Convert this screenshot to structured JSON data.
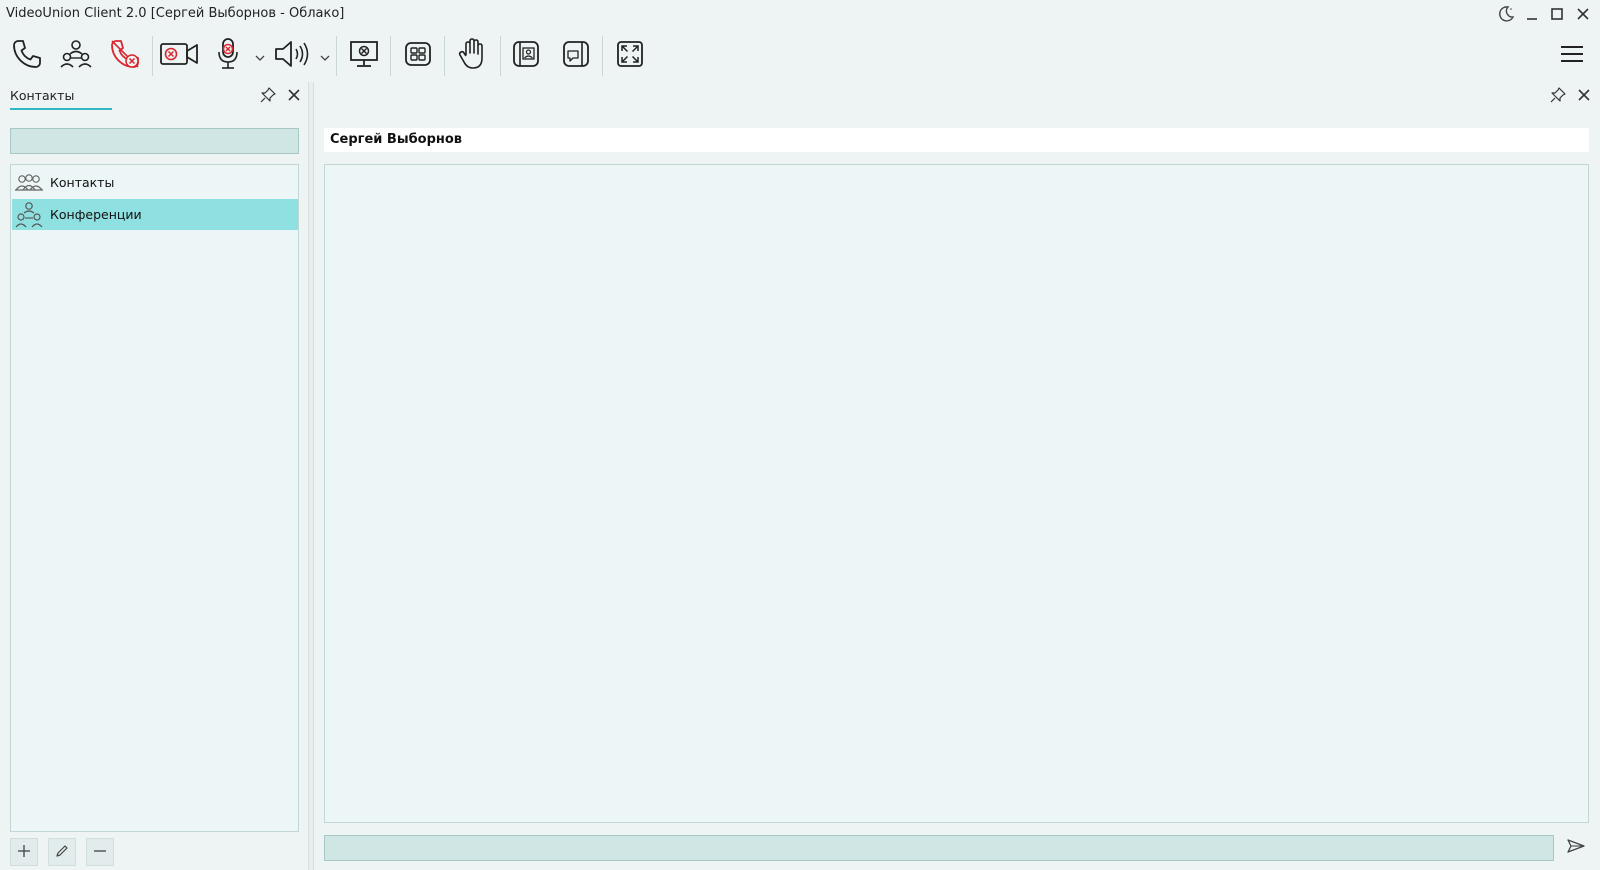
{
  "window": {
    "title": "VideoUnion Client 2.0 [Сергей Выборнов - Облако]",
    "controls": [
      "theme-moon-icon",
      "minimize-icon",
      "maximize-icon",
      "close-icon"
    ]
  },
  "toolbar": {
    "buttons": [
      {
        "name": "call-button",
        "icon": "phone-icon"
      },
      {
        "name": "conference-button",
        "icon": "conference-icon"
      },
      {
        "name": "hangup-button",
        "icon": "phone-off-icon",
        "state": "disabled-red"
      },
      {
        "name": "camera-button",
        "icon": "camera-off-icon",
        "state": "muted"
      },
      {
        "name": "microphone-button",
        "icon": "microphone-off-icon",
        "state": "muted"
      },
      {
        "name": "speaker-button",
        "icon": "speaker-icon"
      },
      {
        "name": "screen-share-button",
        "icon": "screen-share-icon"
      },
      {
        "name": "layout-button",
        "icon": "grid-layout-icon"
      },
      {
        "name": "raise-hand-button",
        "icon": "hand-icon"
      },
      {
        "name": "self-view-button",
        "icon": "self-view-icon"
      },
      {
        "name": "remote-view-button",
        "icon": "remote-view-icon"
      },
      {
        "name": "fullscreen-button",
        "icon": "fullscreen-icon"
      },
      {
        "name": "menu-button",
        "icon": "hamburger-menu-icon"
      }
    ]
  },
  "left_panel": {
    "tab_label": "Контакты",
    "search": {
      "value": "",
      "placeholder": ""
    },
    "tree": [
      {
        "label": "Контакты",
        "icon": "contacts-group-icon",
        "selected": false
      },
      {
        "label": "Конференции",
        "icon": "conference-group-icon",
        "selected": true
      }
    ],
    "bottom_actions": [
      "add-icon",
      "edit-pencil-icon",
      "remove-icon"
    ]
  },
  "chat": {
    "header": "Сергей Выборнов",
    "message_input": {
      "value": "",
      "placeholder": ""
    }
  },
  "colors": {
    "background": "#eef4f4",
    "accent": "#33b5c6",
    "selected_row": "#8fe0e0",
    "input_bg": "#cfe6e4",
    "alert_red": "#d9262e"
  }
}
